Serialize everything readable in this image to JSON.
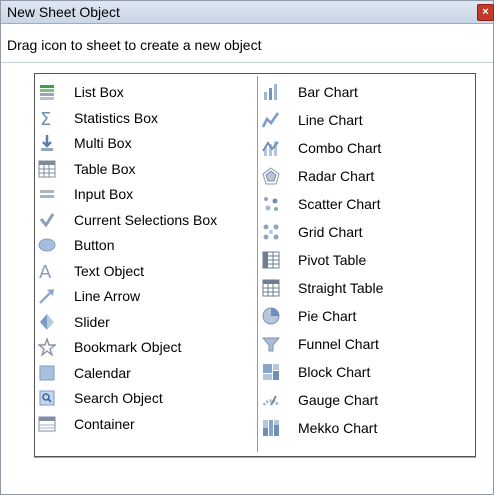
{
  "window": {
    "title": "New Sheet Object",
    "close_symbol": "×"
  },
  "instruction": "Drag icon to sheet to create a new object",
  "left_items": [
    {
      "label": "List Box",
      "icon": "list-box-icon"
    },
    {
      "label": "Statistics Box",
      "icon": "statistics-box-icon"
    },
    {
      "label": "Multi Box",
      "icon": "multi-box-icon"
    },
    {
      "label": "Table Box",
      "icon": "table-box-icon"
    },
    {
      "label": "Input Box",
      "icon": "input-box-icon"
    },
    {
      "label": "Current Selections Box",
      "icon": "current-selections-icon"
    },
    {
      "label": "Button",
      "icon": "button-icon"
    },
    {
      "label": "Text Object",
      "icon": "text-object-icon"
    },
    {
      "label": "Line Arrow",
      "icon": "line-arrow-icon"
    },
    {
      "label": "Slider",
      "icon": "slider-icon"
    },
    {
      "label": "Bookmark Object",
      "icon": "bookmark-icon"
    },
    {
      "label": "Calendar",
      "icon": "calendar-icon"
    },
    {
      "label": "Search Object",
      "icon": "search-object-icon"
    },
    {
      "label": "Container",
      "icon": "container-icon"
    }
  ],
  "right_items": [
    {
      "label": "Bar Chart",
      "icon": "bar-chart-icon"
    },
    {
      "label": "Line Chart",
      "icon": "line-chart-icon"
    },
    {
      "label": "Combo Chart",
      "icon": "combo-chart-icon"
    },
    {
      "label": "Radar Chart",
      "icon": "radar-chart-icon"
    },
    {
      "label": "Scatter Chart",
      "icon": "scatter-chart-icon"
    },
    {
      "label": "Grid Chart",
      "icon": "grid-chart-icon"
    },
    {
      "label": "Pivot Table",
      "icon": "pivot-table-icon"
    },
    {
      "label": "Straight Table",
      "icon": "straight-table-icon"
    },
    {
      "label": "Pie Chart",
      "icon": "pie-chart-icon"
    },
    {
      "label": "Funnel Chart",
      "icon": "funnel-chart-icon"
    },
    {
      "label": "Block Chart",
      "icon": "block-chart-icon"
    },
    {
      "label": "Gauge Chart",
      "icon": "gauge-chart-icon"
    },
    {
      "label": "Mekko Chart",
      "icon": "mekko-chart-icon"
    }
  ]
}
